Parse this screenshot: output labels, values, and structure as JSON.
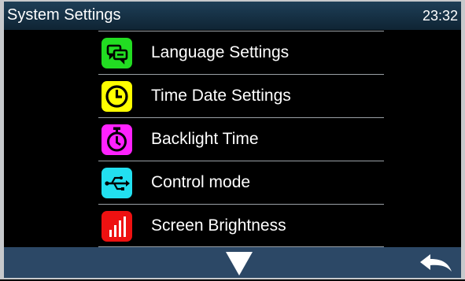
{
  "header": {
    "title": "System Settings",
    "time": "23:32"
  },
  "menu": {
    "items": [
      {
        "label": "Language Settings",
        "icon": "language-chat-icon",
        "color": "#22dd22"
      },
      {
        "label": "Time Date Settings",
        "icon": "clock-icon",
        "color": "#ffff00"
      },
      {
        "label": "Backlight Time",
        "icon": "stopwatch-icon",
        "color": "#ff22ff"
      },
      {
        "label": "Control mode",
        "icon": "usb-icon",
        "color": "#22e0f0"
      },
      {
        "label": "Screen Brightness",
        "icon": "brightness-bars-icon",
        "color": "#ee1111"
      }
    ]
  },
  "footer": {
    "down_icon": "triangle-down-icon",
    "back_icon": "return-arrow-icon",
    "bar_color": "#2c4866",
    "header_color": "#1a3448"
  }
}
